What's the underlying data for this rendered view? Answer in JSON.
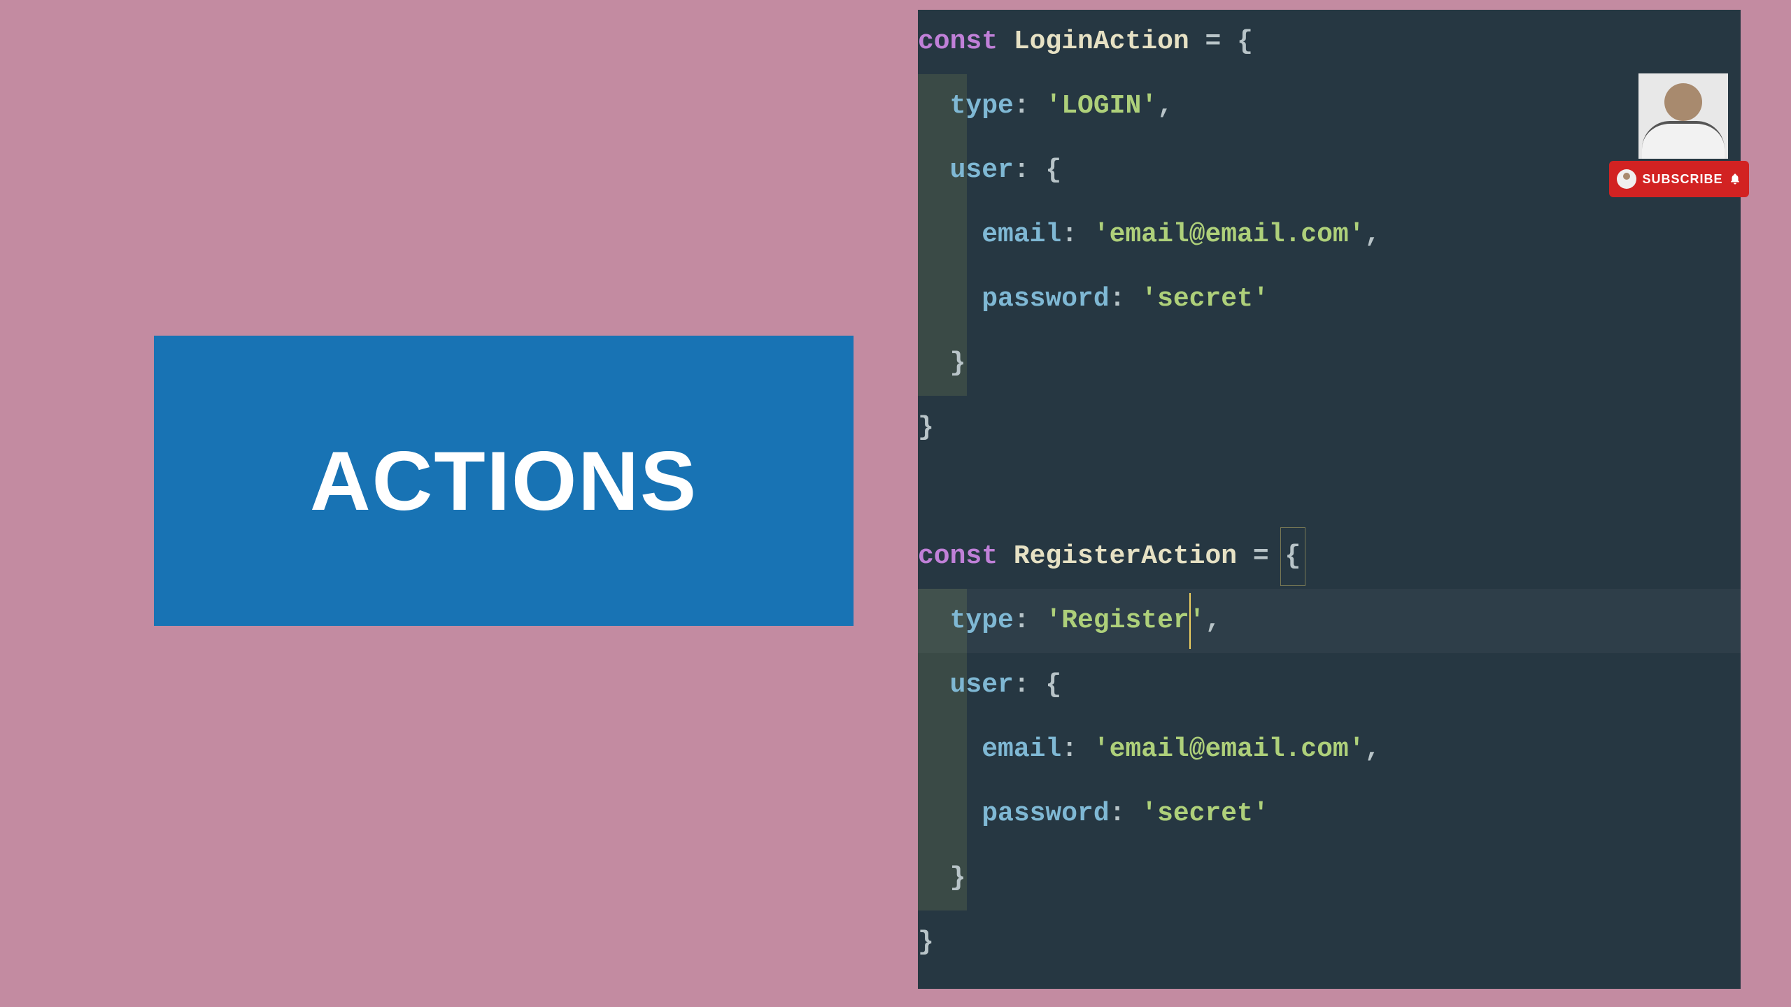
{
  "actions_box": {
    "title": "ACTIONS"
  },
  "subscribe": {
    "label": "SUBSCRIBE"
  },
  "code": {
    "lines": [
      [
        {
          "t": "const",
          "c": "kw"
        },
        {
          "t": " ",
          "c": "op"
        },
        {
          "t": "LoginAction",
          "c": "ident"
        },
        {
          "t": " = {",
          "c": "op"
        }
      ],
      [
        {
          "t": "  ",
          "c": "op"
        },
        {
          "t": "type",
          "c": "prop"
        },
        {
          "t": ": ",
          "c": "op"
        },
        {
          "t": "'LOGIN'",
          "c": "str"
        },
        {
          "t": ",",
          "c": "op"
        }
      ],
      [
        {
          "t": "  ",
          "c": "op"
        },
        {
          "t": "user",
          "c": "prop"
        },
        {
          "t": ": {",
          "c": "op"
        }
      ],
      [
        {
          "t": "    ",
          "c": "op"
        },
        {
          "t": "email",
          "c": "prop"
        },
        {
          "t": ": ",
          "c": "op"
        },
        {
          "t": "'email@email.com'",
          "c": "str"
        },
        {
          "t": ",",
          "c": "op"
        }
      ],
      [
        {
          "t": "    ",
          "c": "op"
        },
        {
          "t": "password",
          "c": "prop"
        },
        {
          "t": ": ",
          "c": "op"
        },
        {
          "t": "'secret'",
          "c": "str"
        }
      ],
      [
        {
          "t": "  }",
          "c": "op"
        }
      ],
      [
        {
          "t": "}",
          "c": "op"
        }
      ],
      [
        {
          "t": "",
          "c": "op"
        }
      ],
      [
        {
          "t": "const",
          "c": "kw"
        },
        {
          "t": " ",
          "c": "op"
        },
        {
          "t": "RegisterAction",
          "c": "ident"
        },
        {
          "t": " = {",
          "c": "op"
        }
      ],
      [
        {
          "t": "  ",
          "c": "op"
        },
        {
          "t": "type",
          "c": "prop"
        },
        {
          "t": ": ",
          "c": "op"
        },
        {
          "t": "'Register'",
          "c": "str"
        },
        {
          "t": ",",
          "c": "op"
        }
      ],
      [
        {
          "t": "  ",
          "c": "op"
        },
        {
          "t": "user",
          "c": "prop"
        },
        {
          "t": ": {",
          "c": "op"
        }
      ],
      [
        {
          "t": "    ",
          "c": "op"
        },
        {
          "t": "email",
          "c": "prop"
        },
        {
          "t": ": ",
          "c": "op"
        },
        {
          "t": "'email@email.com'",
          "c": "str"
        },
        {
          "t": ",",
          "c": "op"
        }
      ],
      [
        {
          "t": "    ",
          "c": "op"
        },
        {
          "t": "password",
          "c": "prop"
        },
        {
          "t": ": ",
          "c": "op"
        },
        {
          "t": "'secret'",
          "c": "str"
        }
      ],
      [
        {
          "t": "  }",
          "c": "op"
        }
      ],
      [
        {
          "t": "}",
          "c": "op"
        }
      ]
    ],
    "gutter_blocks": [
      {
        "from": 1,
        "to": 5
      },
      {
        "from": 9,
        "to": 13
      }
    ],
    "highlighted_line": 9,
    "cursor": {
      "line": 9,
      "col": 17
    },
    "brace_match": {
      "line": 8,
      "col": 23
    }
  }
}
